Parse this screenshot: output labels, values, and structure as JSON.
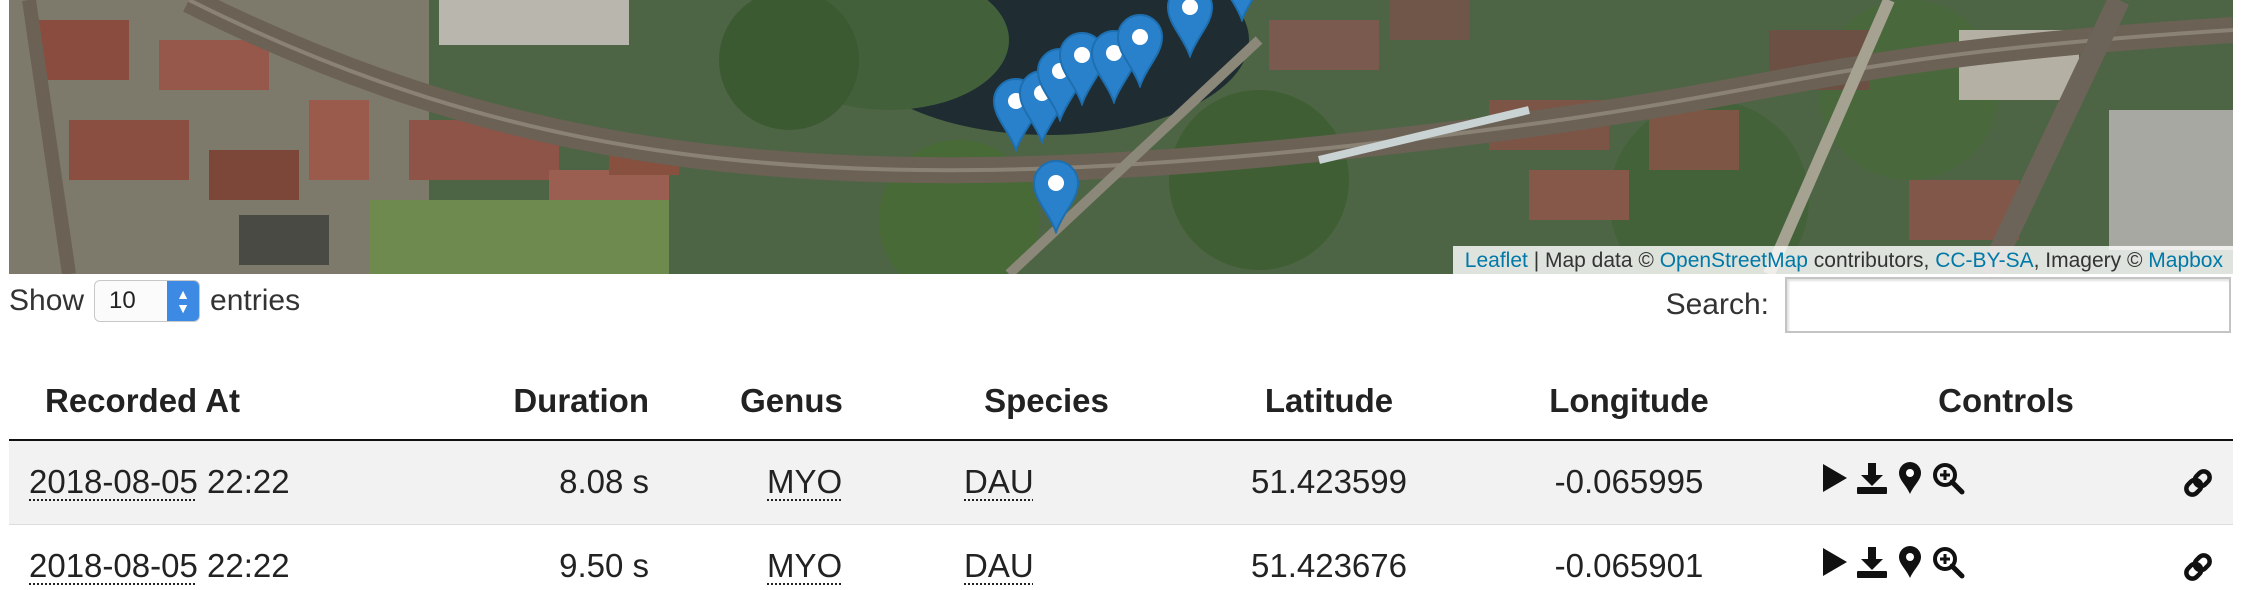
{
  "map": {
    "attribution": {
      "leaflet": "Leaflet",
      "sep1": " | Map data © ",
      "osm": "OpenStreetMap",
      "contributors": " contributors, ",
      "license": "CC-BY-SA",
      "imagery": ", Imagery © ",
      "mapbox": "Mapbox"
    },
    "marker_icon": "map-pin-icon",
    "marker_color": "#2a81cb"
  },
  "length_menu": {
    "prefix": "Show",
    "value": "10",
    "suffix": "entries"
  },
  "search": {
    "label": "Search:",
    "value": "",
    "placeholder": ""
  },
  "table": {
    "columns": [
      "Recorded At",
      "Duration",
      "Genus",
      "Species",
      "Latitude",
      "Longitude",
      "Controls"
    ],
    "rows": [
      {
        "date": "2018-08-05",
        "time": "22:22",
        "duration": "8.08 s",
        "genus": "MYO",
        "species": "DAU",
        "latitude": "51.423599",
        "longitude": "-0.065995"
      },
      {
        "date": "2018-08-05",
        "time": "22:22",
        "duration": "9.50 s",
        "genus": "MYO",
        "species": "DAU",
        "latitude": "51.423676",
        "longitude": "-0.065901"
      }
    ],
    "control_icons": [
      "play-icon",
      "download-icon",
      "map-marker-icon",
      "zoom-in-icon",
      "link-icon"
    ]
  }
}
